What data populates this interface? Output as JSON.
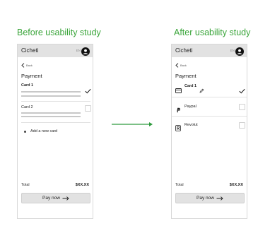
{
  "before": {
    "heading": "Before usability study",
    "app_title": "Cicheti",
    "lang": "EN",
    "back_label": "Back",
    "page_title": "Payment",
    "cards": [
      {
        "label": "Card 1",
        "selected": true
      },
      {
        "label": "Card 2",
        "selected": false
      }
    ],
    "add_card_label": "Add a new card",
    "total_label": "Total",
    "total_value": "$XX.XX",
    "pay_label": "Pay now"
  },
  "after": {
    "heading": "After usability study",
    "app_title": "Cicheti",
    "lang": "EN",
    "back_label": "Back",
    "page_title": "Payment",
    "methods": [
      {
        "label": "Card 1",
        "icon": "credit-card-icon",
        "selected": true
      },
      {
        "label": "Paypal",
        "icon": "paypal-icon",
        "selected": false
      },
      {
        "label": "Revolut",
        "icon": "revolut-icon",
        "selected": false
      }
    ],
    "total_label": "Total",
    "total_value": "$XX.XX",
    "pay_label": "Pay now"
  },
  "colors": {
    "heading": "#3aa53a",
    "arrow": "#2e9a3e",
    "appbar": "#e2e2e2",
    "button": "#e2e2e2"
  }
}
